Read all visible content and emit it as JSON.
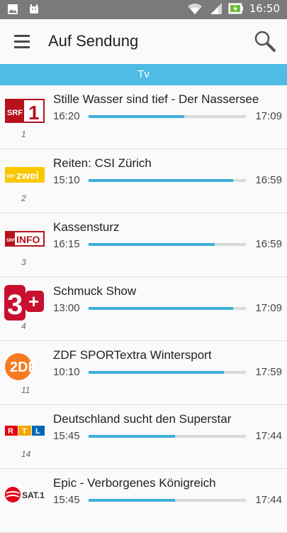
{
  "status": {
    "time": "16:50"
  },
  "header": {
    "title": "Auf Sendung"
  },
  "tab": {
    "label": "Tv"
  },
  "colors": {
    "accent": "#4fbce6",
    "progress": "#3aafd9",
    "statusbar": "#7a7a7a"
  },
  "programs": [
    {
      "channel_number": "1",
      "logo": "srf1-logo",
      "title": "Stille Wasser sind tief - Der Nassersee",
      "start": "16:20",
      "end": "17:09",
      "progress": 0.61
    },
    {
      "channel_number": "2",
      "logo": "srfzwei-logo",
      "title": "Reiten: CSI Zürich",
      "start": "15:10",
      "end": "16:59",
      "progress": 0.92
    },
    {
      "channel_number": "3",
      "logo": "srfinfo-logo",
      "title": "Kassensturz",
      "start": "16:15",
      "end": "16:59",
      "progress": 0.8
    },
    {
      "channel_number": "4",
      "logo": "3plus-logo",
      "title": "Schmuck Show",
      "start": "13:00",
      "end": "17:09",
      "progress": 0.92
    },
    {
      "channel_number": "11",
      "logo": "zdf-logo",
      "title": "ZDF SPORTextra Wintersport",
      "start": "10:10",
      "end": "17:59",
      "progress": 0.86
    },
    {
      "channel_number": "14",
      "logo": "rtl-logo",
      "title": "Deutschland sucht den Superstar",
      "start": "15:45",
      "end": "17:44",
      "progress": 0.55
    },
    {
      "channel_number": "",
      "logo": "sat1-logo",
      "title": "Epic - Verborgenes Königreich",
      "start": "15:45",
      "end": "17:44",
      "progress": 0.55
    }
  ]
}
